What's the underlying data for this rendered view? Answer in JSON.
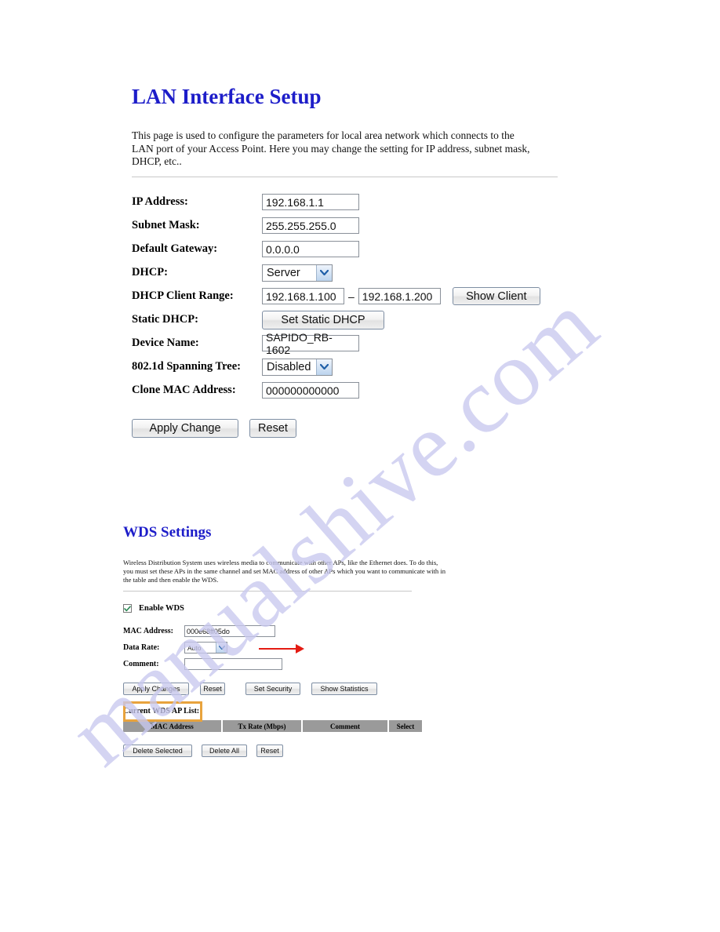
{
  "watermark": {
    "text": "manualshive.com"
  },
  "lan": {
    "heading": "LAN Interface Setup",
    "description": "This page is used to configure the parameters for local area network which connects to the LAN port of your Access Point. Here you may change the setting for IP address, subnet mask, DHCP, etc..",
    "fields": {
      "ip_address_label": "IP Address:",
      "ip_address_value": "192.168.1.1",
      "subnet_mask_label": "Subnet Mask:",
      "subnet_mask_value": "255.255.255.0",
      "default_gateway_label": "Default Gateway:",
      "default_gateway_value": "0.0.0.0",
      "dhcp_label": "DHCP:",
      "dhcp_value": "Server",
      "dhcp_client_range_label": "DHCP Client Range:",
      "dhcp_range_start": "192.168.1.100",
      "dhcp_range_separator": "–",
      "dhcp_range_end": "192.168.1.200",
      "show_client_button": "Show Client",
      "static_dhcp_label": "Static DHCP:",
      "set_static_dhcp_button": "Set Static DHCP",
      "device_name_label": "Device Name:",
      "device_name_value": "SAPIDO_RB-1602",
      "spanning_tree_label": "802.1d Spanning Tree:",
      "spanning_tree_value": "Disabled",
      "clone_mac_label": "Clone MAC Address:",
      "clone_mac_value": "000000000000"
    },
    "apply_button": "Apply Change",
    "reset_button": "Reset"
  },
  "wds": {
    "heading": "WDS Settings",
    "description": "Wireless Distribution System uses wireless media to communicate with other APs, like the Ethernet does. To do this, you must set these APs in the same channel and set MAC address of other APs which you want to communicate with in the table and then enable the WDS.",
    "enable_label": "Enable WDS",
    "enable_checked": true,
    "fields": {
      "mac_address_label": "MAC Address:",
      "mac_address_value": "000e68ff05do",
      "data_rate_label": "Data Rate:",
      "data_rate_value": "Auto",
      "comment_label": "Comment:",
      "comment_value": ""
    },
    "buttons": {
      "apply": "Apply Changes",
      "reset": "Reset",
      "set_security": "Set Security",
      "show_statistics": "Show Statistics"
    },
    "list_title": "Current WDS AP List:",
    "table_headers": [
      "MAC Address",
      "Tx Rate (Mbps)",
      "Comment",
      "Select"
    ],
    "table_rows": [],
    "bottom_buttons": {
      "delete_selected": "Delete Selected",
      "delete_all": "Delete All",
      "reset": "Reset"
    }
  },
  "annotations": {
    "arrow_color": "#e41b13",
    "highlight_color": "#e8a33d"
  }
}
